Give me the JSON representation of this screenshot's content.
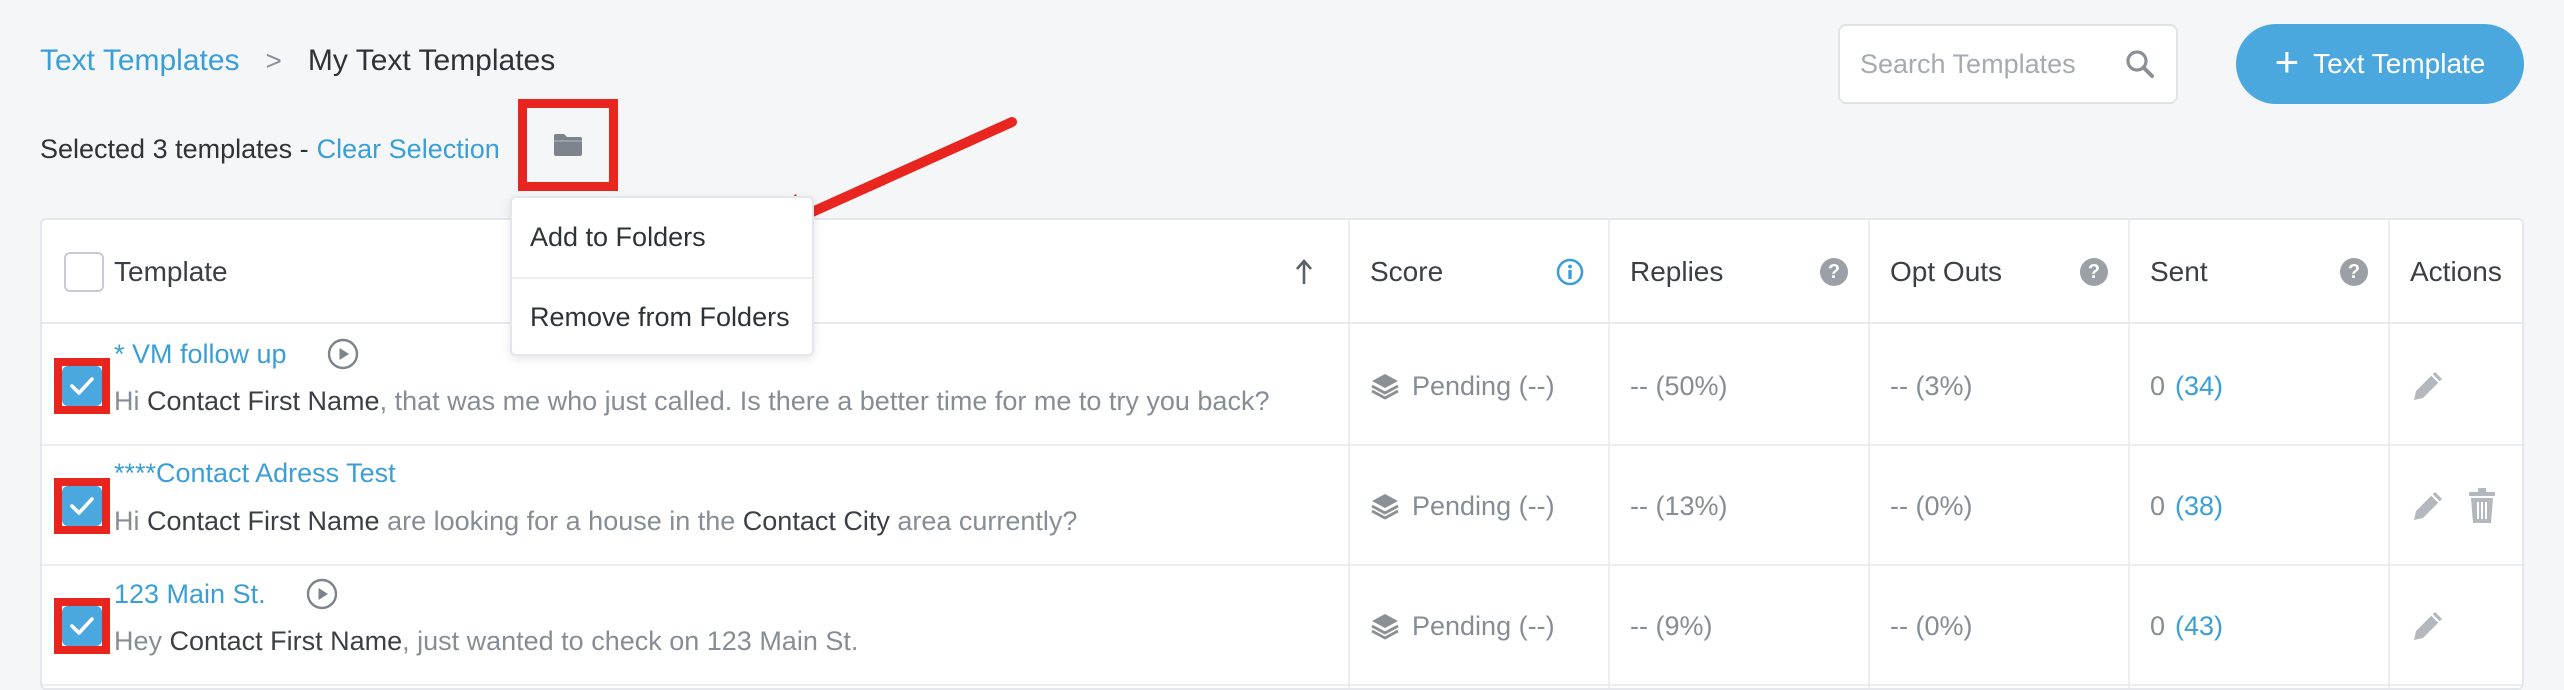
{
  "breadcrumb": {
    "parent": "Text Templates",
    "separator": ">",
    "current": "My Text Templates"
  },
  "search": {
    "placeholder": "Search Templates"
  },
  "add_button": {
    "icon": "+",
    "label": "Text Template"
  },
  "selection": {
    "text": "Selected 3 templates -",
    "clear_label": "Clear Selection"
  },
  "folder_menu": {
    "items": [
      "Add to Folders",
      "Remove from Folders"
    ]
  },
  "table": {
    "columns": [
      "Template",
      "Score",
      "Replies",
      "Opt Outs",
      "Sent",
      "Actions"
    ],
    "rows": [
      {
        "name": "* VM follow up",
        "body": [
          [
            "Hi ",
            false
          ],
          [
            "Contact First Name",
            true
          ],
          [
            ", that was me who just called. Is there a better time for me to try you back?",
            false
          ]
        ],
        "score": "Pending (--)",
        "replies": "-- (50%)",
        "optouts": "-- (3%)",
        "sent": "0",
        "sent_total": "(34)",
        "checked": true,
        "has_play": true,
        "has_delete": false
      },
      {
        "name": "****Contact Adress Test",
        "body": [
          [
            "Hi ",
            false
          ],
          [
            "Contact First Name",
            true
          ],
          [
            " are looking for a house in the ",
            false
          ],
          [
            "Contact City",
            true
          ],
          [
            " area currently?",
            false
          ]
        ],
        "score": "Pending (--)",
        "replies": "-- (13%)",
        "optouts": "-- (0%)",
        "sent": "0",
        "sent_total": "(38)",
        "checked": true,
        "has_play": false,
        "has_delete": true
      },
      {
        "name": "123 Main St.",
        "body": [
          [
            "Hey ",
            false
          ],
          [
            "Contact First Name",
            true
          ],
          [
            ", just wanted to check on 123 Main St.",
            false
          ]
        ],
        "score": "Pending (--)",
        "replies": "-- (9%)",
        "optouts": "-- (0%)",
        "sent": "0",
        "sent_total": "(43)",
        "checked": true,
        "has_play": true,
        "has_delete": false
      }
    ]
  },
  "colors": {
    "accent": "#4aa8de",
    "link": "#3a9fd6",
    "annotation": "#e8261f"
  },
  "icons": [
    "search-icon",
    "plus-icon",
    "folder-icon",
    "sort-up-icon",
    "info-icon",
    "help-icon",
    "play-icon",
    "layers-icon",
    "pencil-icon",
    "trash-icon",
    "check-icon"
  ]
}
